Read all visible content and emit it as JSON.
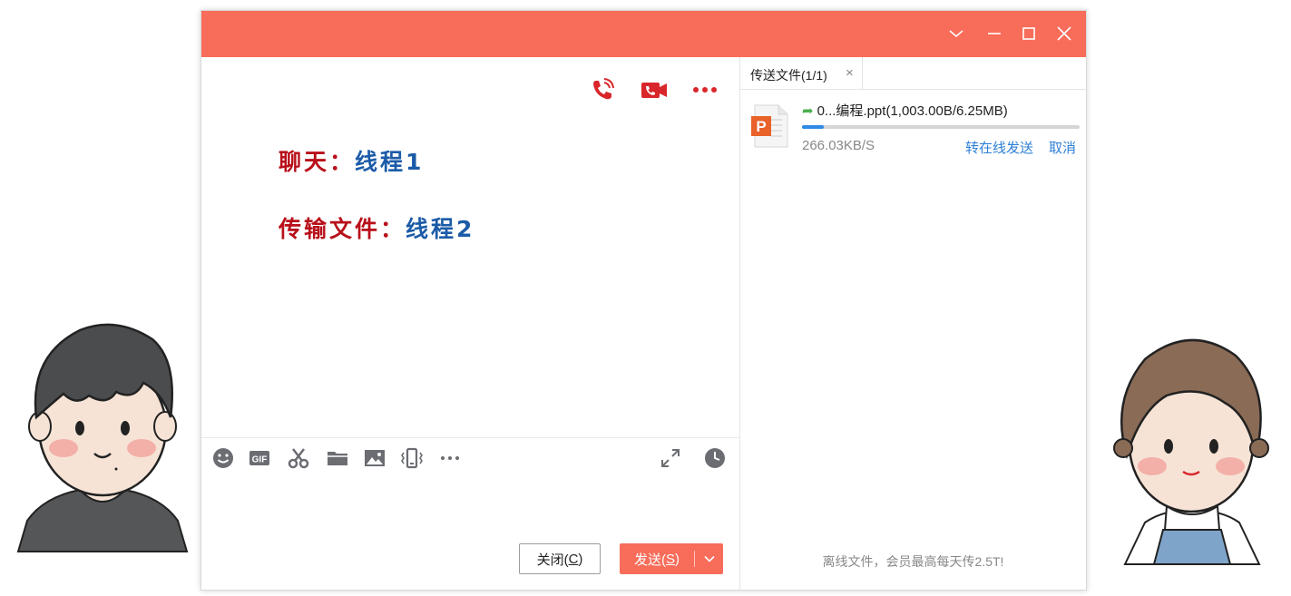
{
  "colors": {
    "accent": "#f86c5a",
    "icon_red": "#d9262a",
    "chat_label": "#b8101a",
    "chat_value": "#1c5ba8",
    "link": "#2e7fd6"
  },
  "titlebar": {
    "icons": [
      "chevron-down-icon",
      "minimize-icon",
      "maximize-icon",
      "close-icon"
    ]
  },
  "chat": {
    "top_icons": [
      "phone-call-icon",
      "video-call-icon",
      "more-icon"
    ],
    "lines": [
      {
        "label": "聊天：",
        "value": "线程1"
      },
      {
        "label": "传输文件：",
        "value": "线程2"
      }
    ],
    "toolbar_icons": [
      "emoji-icon",
      "gif-icon",
      "scissors-icon",
      "folder-icon",
      "image-icon",
      "shake-icon",
      "more-dots-icon",
      "expand-icon",
      "history-clock-icon"
    ],
    "close_button": {
      "label": "关闭(",
      "key": "C",
      "suffix": ")"
    },
    "send_button": {
      "label": "发送(",
      "key": "S",
      "suffix": ")",
      "dropdown_icon": "chevron-down-icon"
    }
  },
  "transfer": {
    "tab_label": "传送文件(1/1)",
    "tab_close": "×",
    "file": {
      "icon": "powerpoint-file-icon",
      "icon_letter": "P",
      "name": "0...编程.ppt(1,003.00B/6.25MB)",
      "progress": 0.08,
      "speed": "266.03KB/S",
      "action_online": "转在线发送",
      "action_cancel": "取消"
    },
    "footer_note": "离线文件，会员最高每天传2.5T!"
  }
}
